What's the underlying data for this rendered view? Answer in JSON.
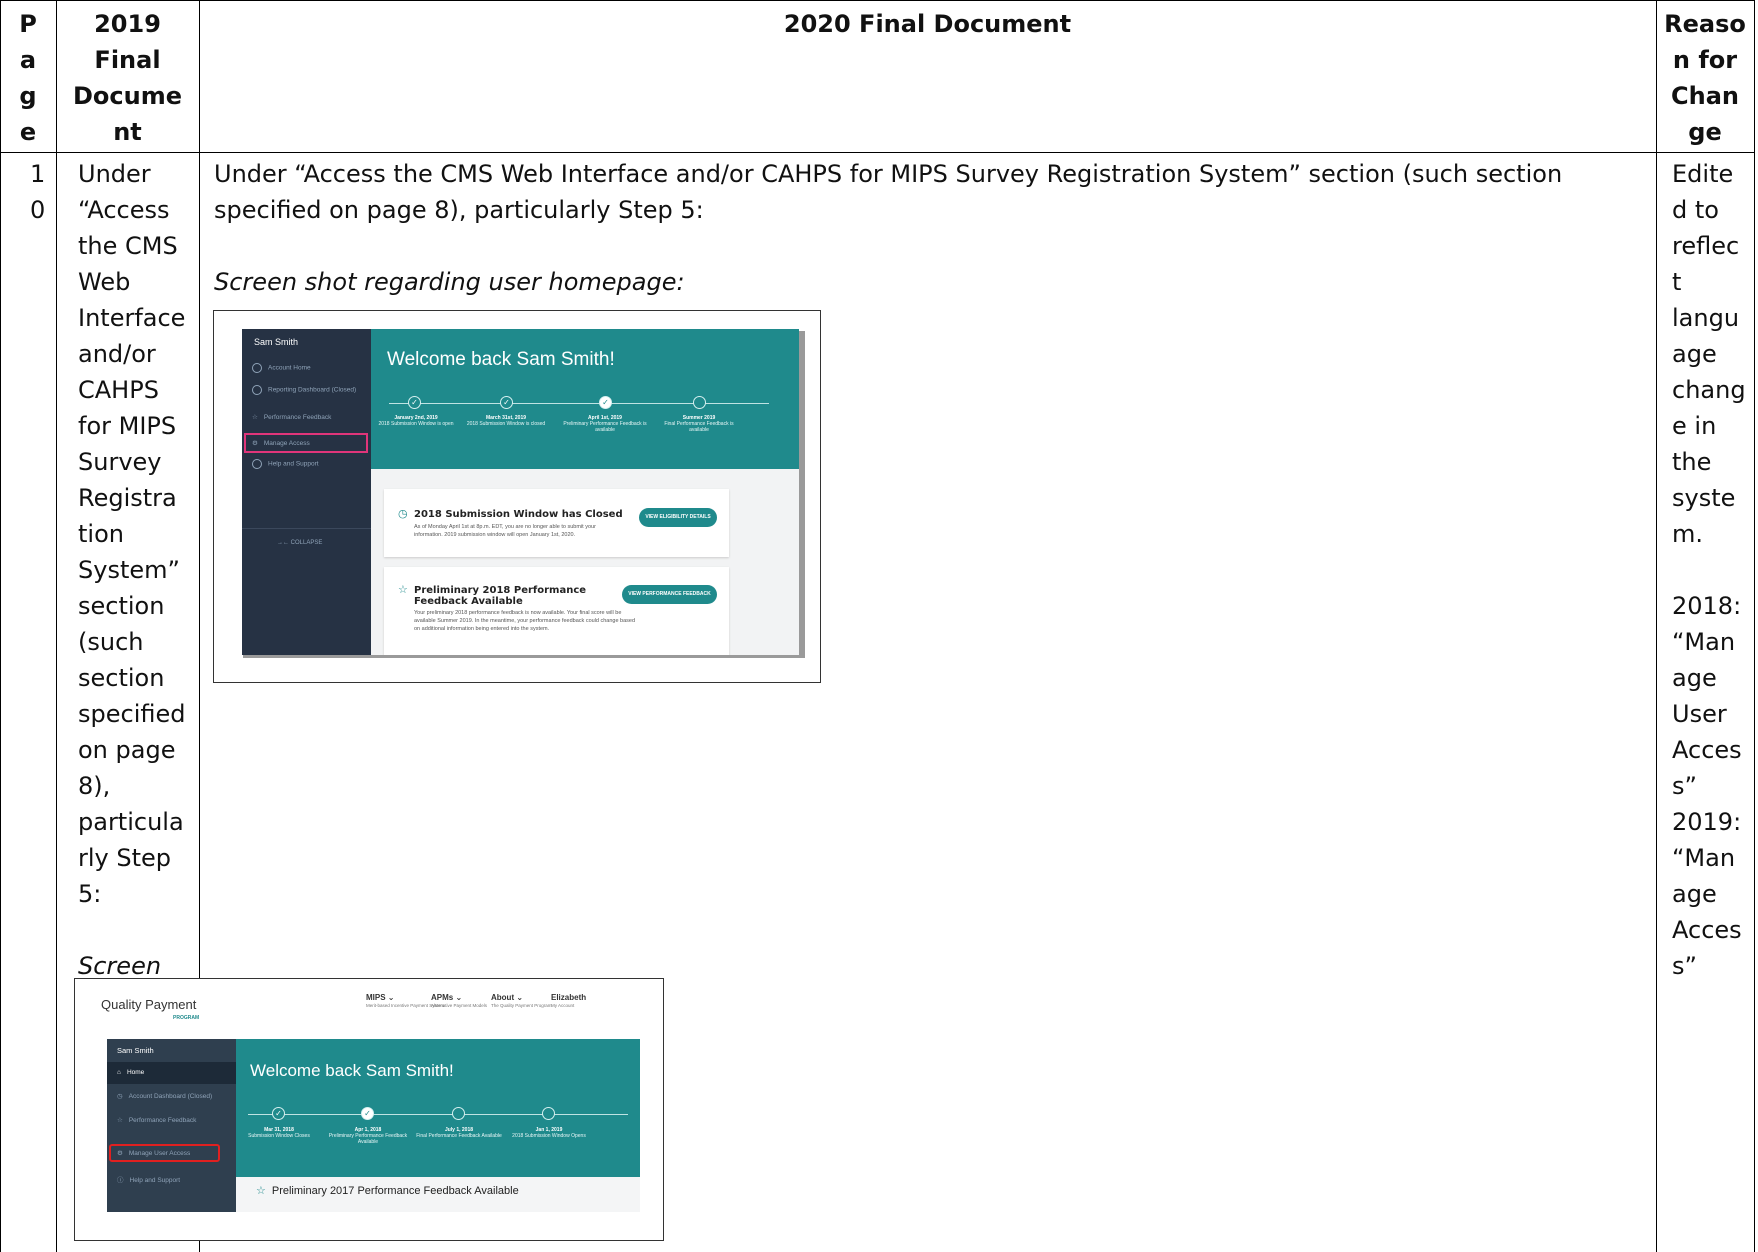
{
  "table": {
    "headers": {
      "page": [
        "P",
        "a",
        "g",
        "e"
      ],
      "prev_doc": [
        "2019",
        "Final",
        "Docume",
        "nt"
      ],
      "new_doc": "2020 Final Document",
      "reason": [
        "Reaso",
        "n for",
        "Chan",
        "ge"
      ]
    },
    "row": {
      "page": [
        "1",
        "0"
      ],
      "prev_doc_lines": [
        "Under",
        "“Access",
        "the CMS",
        "Web",
        "Interface",
        "and/or",
        "CAHPS",
        "for MIPS",
        "Survey",
        "Registra",
        "tion",
        "System”",
        "section",
        "(such",
        "section",
        "specified",
        "on page",
        "8),",
        "particula",
        "rly Step",
        "5:"
      ],
      "prev_doc_caption": "Screen",
      "new_doc_line1": "Under “Access the CMS Web Interface and/or CAHPS for MIPS Survey Registration System” section (such section",
      "new_doc_line2": "specified on page 8), particularly Step 5:",
      "new_doc_caption": "Screen shot regarding user homepage:",
      "reason_lines": [
        "Edite",
        "d to",
        "reflec",
        "t",
        "langu",
        "age",
        "chang",
        "e in",
        "the",
        "syste",
        "m.",
        "",
        "2018:",
        "“Man",
        "age",
        "User",
        "Acces",
        "s”",
        "2019:",
        "“Man",
        "age",
        "Acces",
        "s”"
      ]
    }
  },
  "screenshot_new": {
    "user_name": "Sam Smith",
    "nav_items": [
      "Account Home",
      "Reporting Dashboard (Closed)",
      "Performance Feedback",
      "Manage Access",
      "Help and Support"
    ],
    "collapse": "→← COLLAPSE",
    "welcome": "Welcome back Sam Smith!",
    "milestones": [
      {
        "date": "January 2nd, 2019",
        "desc": "2018 Submission Window is open"
      },
      {
        "date": "March 31st, 2019",
        "desc": "2018 Submission Window is closed"
      },
      {
        "date": "April 1st, 2019",
        "desc": "Preliminary Performance Feedback is available"
      },
      {
        "date": "Summer 2019",
        "desc": "Final Performance Feedback is available"
      }
    ],
    "card1": {
      "title": "2018 Submission Window has Closed",
      "body": "As of Monday April 1st at 8p.m. EDT, you are no longer able to submit your information. 2019 submission window will open January 1st, 2020.",
      "button": "VIEW ELIGIBILITY DETAILS"
    },
    "card2": {
      "title": "Preliminary 2018 Performance Feedback Available",
      "body": "Your preliminary 2018 performance feedback is now available. Your final score will be available Summer 2019. In the meantime, your performance feedback could change based on additional information being entered into the system.",
      "button": "VIEW PERFORMANCE FEEDBACK"
    },
    "accent": "#1f8a8c",
    "highlight": "#e0357a"
  },
  "screenshot_old": {
    "logo": "Quality Payment",
    "logo_sub": "PROGRAM",
    "nav": [
      {
        "label": "MIPS ⌄",
        "sub": "Merit-based Incentive Payment System"
      },
      {
        "label": "APMs ⌄",
        "sub": "Alternative Payment Models"
      },
      {
        "label": "About ⌄",
        "sub": "The Quality Payment Program"
      },
      {
        "label": "Elizabeth",
        "sub": "My Account"
      }
    ],
    "user_name": "Sam Smith",
    "nav_items": [
      "Home",
      "Account Dashboard (Closed)",
      "Performance Feedback",
      "Manage User Access",
      "Help and Support"
    ],
    "welcome": "Welcome back Sam Smith!",
    "milestones": [
      {
        "date": "Mar 31, 2018",
        "desc": "Submission Window Closes"
      },
      {
        "date": "Apr 1, 2018",
        "desc": "Preliminary Performance Feedback Available"
      },
      {
        "date": "July 1, 2018",
        "desc": "Final Performance Feedback Available"
      },
      {
        "date": "Jan 1, 2019",
        "desc": "2018 Submission Window Opens"
      }
    ],
    "card_title": "Preliminary 2017 Performance Feedback Available",
    "accent": "#1f8a8c",
    "highlight": "#e02020"
  }
}
